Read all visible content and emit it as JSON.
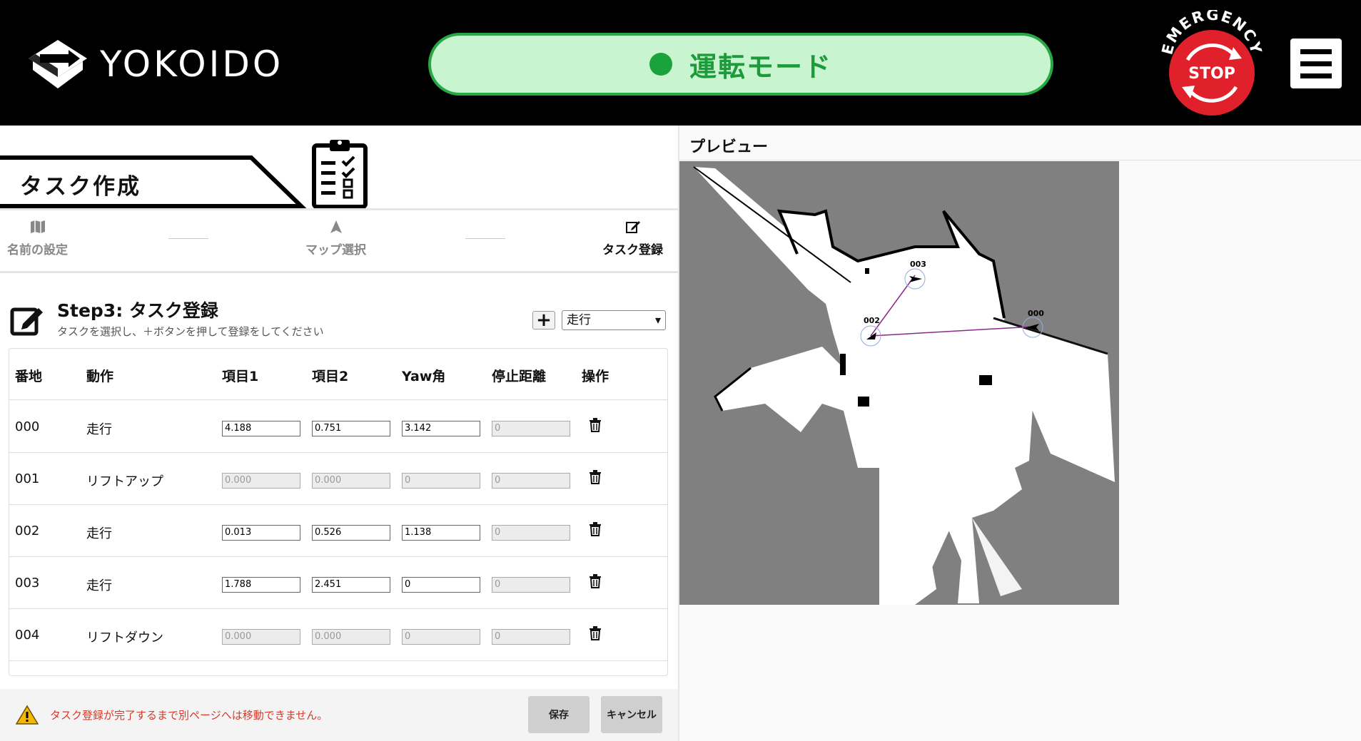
{
  "header": {
    "logo_text": "YOKOIDO",
    "mode_label": "運転モード",
    "estop_top": "EMERGENCY",
    "estop_label": "STOP"
  },
  "left": {
    "page_title": "タスク作成",
    "steps": [
      {
        "label": "名前の設定",
        "icon": "map-icon"
      },
      {
        "label": "マップ選択",
        "icon": "navigation-arrow-icon"
      },
      {
        "label": "タスク登録",
        "icon": "edit-icon"
      }
    ],
    "step3": {
      "title": "Step3: タスク登録",
      "subtitle": "タスクを選択し、＋ボタンを押して登録をしてください",
      "add_label": "+",
      "selected_type": "走行"
    },
    "table": {
      "headers": [
        "番地",
        "動作",
        "項目1",
        "項目2",
        "Yaw角",
        "停止距離",
        "操作"
      ],
      "rows": [
        {
          "addr": "000",
          "action": "走行",
          "v1": "4.188",
          "v2": "0.751",
          "yaw": "3.142",
          "stop": "0",
          "enabled": true
        },
        {
          "addr": "001",
          "action": "リフトアップ",
          "v1": "0.000",
          "v2": "0.000",
          "yaw": "0",
          "stop": "0",
          "enabled": false
        },
        {
          "addr": "002",
          "action": "走行",
          "v1": "0.013",
          "v2": "0.526",
          "yaw": "1.138",
          "stop": "0",
          "enabled": true
        },
        {
          "addr": "003",
          "action": "走行",
          "v1": "1.788",
          "v2": "2.451",
          "yaw": "0",
          "stop": "0",
          "enabled": true
        },
        {
          "addr": "004",
          "action": "リフトダウン",
          "v1": "0.000",
          "v2": "0.000",
          "yaw": "0",
          "stop": "0",
          "enabled": false
        }
      ]
    },
    "footer": {
      "warning": "タスク登録が完了するまで別ページへは移動できません。",
      "save": "保存",
      "cancel": "キャンセル"
    }
  },
  "right": {
    "preview_title": "プレビュー",
    "waypoints": [
      {
        "label": "003"
      },
      {
        "label": "002"
      },
      {
        "label": "000"
      }
    ]
  },
  "colors": {
    "header_bg": "#000000",
    "mode_bg": "#c8f5d0",
    "mode_accent": "#1d9a3a",
    "estop_red": "#e0202a",
    "warn": "#d63a2a",
    "route": "#8a2a8a"
  }
}
